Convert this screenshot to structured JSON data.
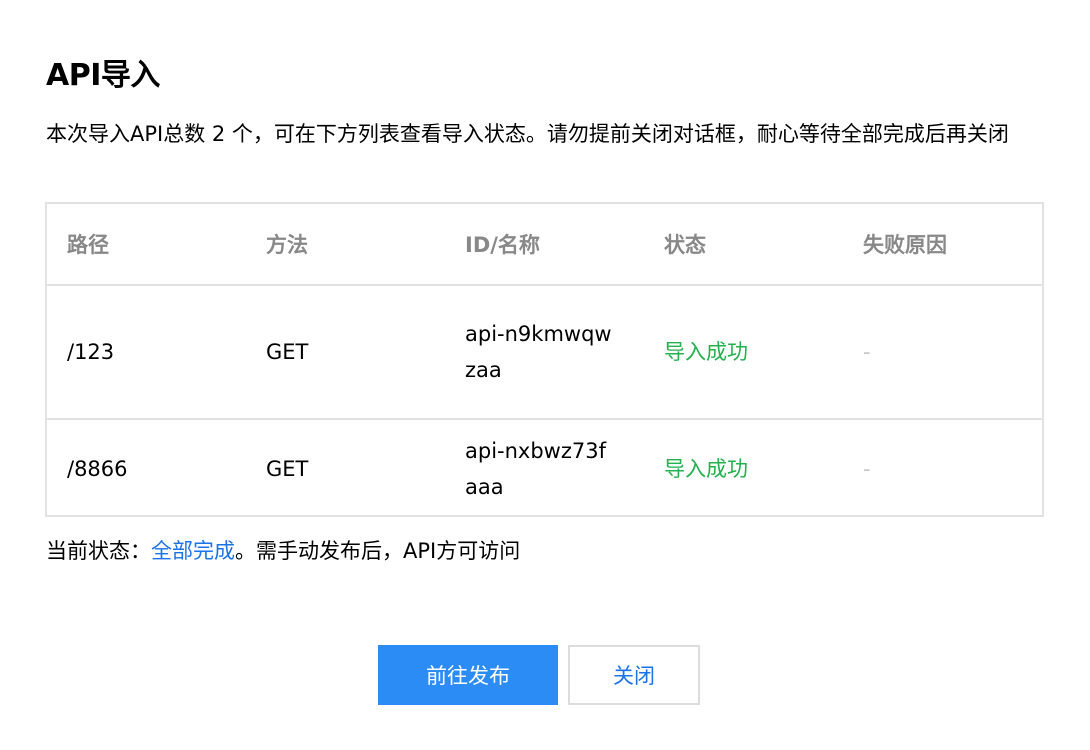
{
  "dialog": {
    "title": "API导入",
    "description": "本次导入API总数 2 个，可在下方列表查看导入状态。请勿提前关闭对话框，耐心等待全部完成后再关闭"
  },
  "table": {
    "headers": [
      "路径",
      "方法",
      "ID/名称",
      "状态",
      "失败原因"
    ],
    "rows": [
      {
        "path": "/123",
        "method": "GET",
        "id": "api-n9kmwqwzaa",
        "status": "导入成功",
        "reason": "-"
      },
      {
        "path": "/8866",
        "method": "GET",
        "id": "api-nxbwz73faaa",
        "status": "导入成功",
        "reason": "-"
      }
    ]
  },
  "footer": {
    "status_prefix": "当前状态：",
    "status_value": "全部完成",
    "status_suffix": "。需手动发布后，API方可访问"
  },
  "buttons": {
    "publish": "前往发布",
    "close": "关闭"
  },
  "colors": {
    "primary": "#2b8cf6",
    "link": "#1a73e8",
    "success": "#22b14c",
    "header_text": "#888888",
    "border": "#e2e2e2"
  }
}
